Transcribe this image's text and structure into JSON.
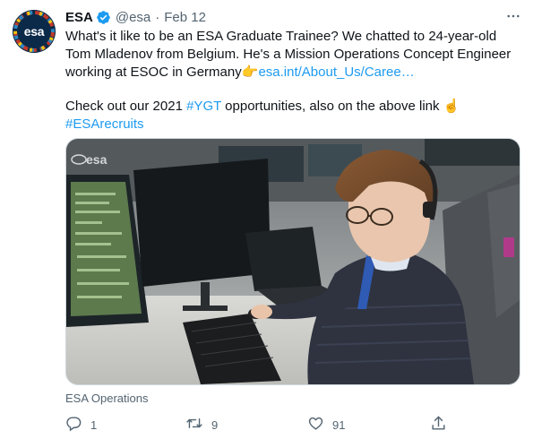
{
  "tweet": {
    "author_name": "ESA",
    "handle": "@esa",
    "separator": "·",
    "date": "Feb 12",
    "avatar_text": "esa",
    "text_line1": "What's it like to be an ESA Graduate Trainee? We chatted to 24-year-old",
    "text_line2": "Tom Mladenov from Belgium. He's a Mission Operations Concept Engineer",
    "text_line3_prefix": "working at ESOC in Germany",
    "text_line3_emoji": "👉",
    "text_line3_link": "esa.int/About_Us/Caree…",
    "text_line4_prefix": "Check out our 2021 ",
    "text_line4_hashtag": "#YGT",
    "text_line4_suffix": " opportunities, also on the above link ",
    "text_line4_emoji": "☝️",
    "text_line5_hashtag": "#ESArecruits",
    "image_watermark": "esa",
    "source_label": "ESA Operations"
  },
  "actions": {
    "reply_count": "1",
    "retweet_count": "9",
    "like_count": "91"
  },
  "icons": {
    "verified": "verified-badge-icon",
    "more": "more-dots-icon",
    "reply": "reply-icon",
    "retweet": "retweet-icon",
    "like": "heart-icon",
    "share": "share-icon"
  },
  "colors": {
    "link": "#1d9bf0",
    "secondary_text": "#536471",
    "avatar_bg": "#0b2a4a"
  }
}
